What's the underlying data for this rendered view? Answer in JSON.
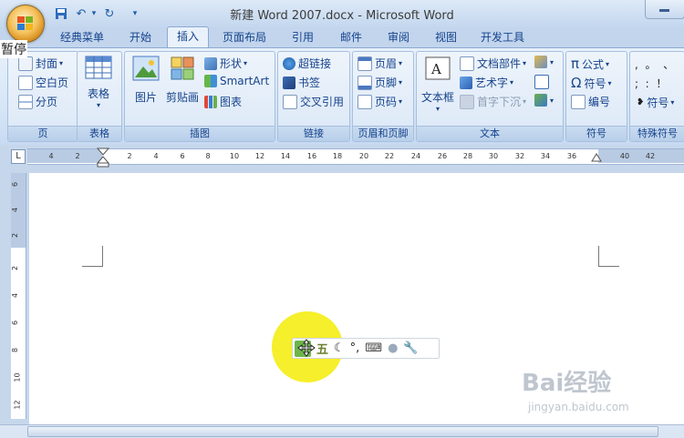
{
  "window": {
    "title": "新建 Word 2007.docx - Microsoft Word"
  },
  "overlay": {
    "stop_label": "暂停"
  },
  "tabs": [
    {
      "label": "经典菜单"
    },
    {
      "label": "开始"
    },
    {
      "label": "插入",
      "active": true
    },
    {
      "label": "页面布局"
    },
    {
      "label": "引用"
    },
    {
      "label": "邮件"
    },
    {
      "label": "审阅"
    },
    {
      "label": "视图"
    },
    {
      "label": "开发工具"
    }
  ],
  "ribbon": {
    "page_group": {
      "label": "页",
      "items": [
        "封面",
        "空白页",
        "分页"
      ]
    },
    "table_group": {
      "label": "表格",
      "button": "表格"
    },
    "illustrations_group": {
      "label": "插图",
      "picture": "图片",
      "clipart": "剪贴画",
      "items": [
        "形状",
        "SmartArt",
        "图表"
      ]
    },
    "links_group": {
      "label": "链接",
      "items": [
        "超链接",
        "书签",
        "交叉引用"
      ]
    },
    "header_footer_group": {
      "label": "页眉和页脚",
      "items": [
        "页眉",
        "页脚",
        "页码"
      ]
    },
    "text_group": {
      "label": "文本",
      "textbox": "文本框",
      "items": [
        "文档部件",
        "艺术字",
        "首字下沉"
      ]
    },
    "symbols_group": {
      "label": "符号",
      "items": [
        "公式",
        "符号",
        "编号"
      ]
    },
    "special_group": {
      "label": "特殊符号",
      "row1": ",  。  、",
      "row2": ";  :  ！",
      "symbol_btn": "符号"
    }
  },
  "ruler": {
    "corner": "L",
    "ticks": [
      "4",
      "2",
      "2",
      "4",
      "6",
      "8",
      "10",
      "12",
      "14",
      "16",
      "18",
      "20",
      "22",
      "24",
      "26",
      "28",
      "30",
      "32",
      "34",
      "36",
      "40",
      "42"
    ],
    "vticks": [
      "6",
      "4",
      "2",
      "2",
      "4",
      "6",
      "8",
      "10",
      "12"
    ]
  },
  "ime": {
    "mode": "五"
  },
  "watermark": {
    "brand": "Bai经验",
    "url": "jingyan.baidu.com"
  },
  "colors": {
    "ribbon": "#dbe8f7",
    "highlight": "#f6ee20"
  }
}
